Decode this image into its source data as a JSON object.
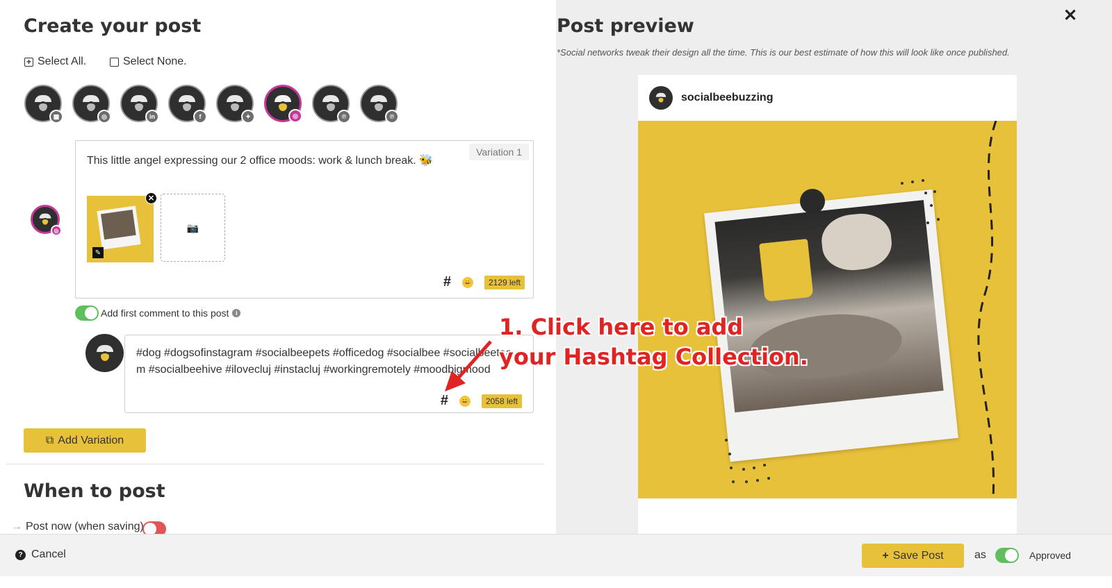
{
  "left": {
    "title": "Create your post",
    "select_all": "Select All.",
    "select_none": "Select None.",
    "profiles": [
      {
        "network": "google-my-business",
        "badge": "▦",
        "active": false
      },
      {
        "network": "instagram",
        "badge": "◎",
        "active": false
      },
      {
        "network": "linkedin",
        "badge": "in",
        "active": false
      },
      {
        "network": "facebook",
        "badge": "f",
        "active": false
      },
      {
        "network": "twitter",
        "badge": "✦",
        "active": false
      },
      {
        "network": "instagram",
        "badge": "◎",
        "active": true
      },
      {
        "network": "pinterest",
        "badge": "℗",
        "active": false
      },
      {
        "network": "pinterest",
        "badge": "℗",
        "active": false
      }
    ],
    "variation_label": "Variation 1",
    "post_text": "This little angel expressing our 2 office moods: work & lunch break. 🐝",
    "hash_symbol": "#",
    "emoji_symbol": "😀",
    "post_chars_left": "2129 left",
    "first_comment_label": "Add first comment to this post",
    "comment_text": "#dog #dogsofinstagram #socialbeepets #officedog #socialbee #socialbeeteam #socialbeehive #ilovecluj #instacluj #workingremotely #moodbigmood",
    "comment_chars_left": "2058 left",
    "add_variation": "Add Variation",
    "when_title": "When to post",
    "post_now": "Post now (when saving)"
  },
  "right": {
    "title": "Post preview",
    "note": "*Social networks tweak their design all the time. This is our best estimate of how this will look like once published.",
    "account_name": "socialbeebuzzing"
  },
  "annotation": {
    "line1": "1. Click here to add",
    "line2": "your Hashtag Collection."
  },
  "footer": {
    "cancel": "Cancel",
    "save": "Save Post",
    "as": "as",
    "status": "Approved"
  },
  "colors": {
    "accent_yellow": "#e8c13a",
    "instagram_pink": "#c8379c",
    "toggle_on": "#5fbf5f",
    "toggle_off": "#e05555",
    "annotation_red": "#e02424"
  },
  "icons": {
    "close": "close-icon",
    "camera": "camera-icon",
    "edit": "pencil-icon",
    "info": "info-icon",
    "help": "question-circle-icon",
    "copy": "copy-icon",
    "plus": "plus-icon"
  }
}
